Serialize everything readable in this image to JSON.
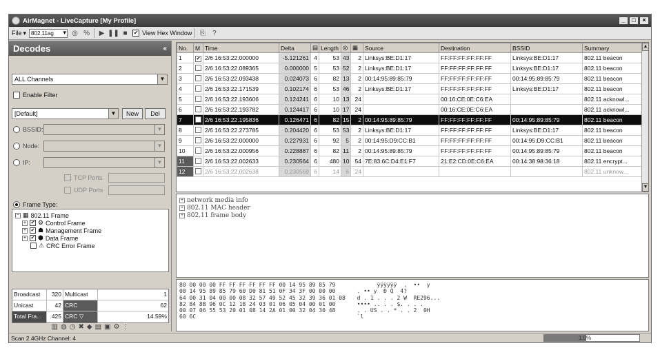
{
  "window": {
    "title": "AirMagnet - LiveCapture [My Profile]",
    "controls": [
      "_",
      "□",
      "×"
    ]
  },
  "toolbar": {
    "file_label": "File",
    "protocol_value": "802.11ag",
    "view_hex_label": "View Hex Window",
    "view_hex_checked": true
  },
  "left": {
    "header": "Decodes",
    "channel_value": "ALL Channels",
    "enable_filter_label": "Enable Filter",
    "filter_value": "[Default]",
    "new_label": "New",
    "del_label": "Del",
    "bssid_label": "BSSID:",
    "node_label": "Node:",
    "ip_label": "IP:",
    "tcp_ports_label": "TCP Ports",
    "udp_ports_label": "UDP Ports",
    "frame_type_label": "Frame Type:",
    "tree": [
      {
        "label": "802.11 Frame",
        "pm": "⊟",
        "level": 0,
        "icon": "frame"
      },
      {
        "label": "Control Frame",
        "pm": "⊞",
        "level": 1,
        "icon": "ctrl"
      },
      {
        "label": "Management Frame",
        "pm": "⊞",
        "level": 1,
        "icon": "mgmt"
      },
      {
        "label": "Data Frame",
        "pm": "⊞",
        "level": 1,
        "icon": "data"
      },
      {
        "label": "CRC Error Frame",
        "pm": "",
        "level": 1,
        "icon": "warn"
      }
    ],
    "stats": {
      "broadcast_label": "Broadcast",
      "broadcast_value": "320",
      "multicast_label": "Multicast",
      "multicast_value": "1",
      "unicast_label": "Unicast",
      "unicast_value": "42",
      "crc_label": "CRC",
      "crc_value": "62",
      "total_label": "Total Fra...",
      "total_value": "425",
      "crc2_label": "CRC",
      "crc2_value": "14.59%"
    }
  },
  "table": {
    "columns": [
      "No.",
      "M",
      "Time",
      "Delta",
      "",
      "Length",
      "",
      "",
      "Source",
      "Destination",
      "BSSID",
      "Summary"
    ],
    "rows": [
      {
        "no": "1",
        "m": "✔",
        "time": "2/6 16:53:22.000000",
        "delta": "-5.121261",
        "c": "4",
        "len": "53",
        "s": "43",
        "f": "2",
        "src": "Linksys:BE:D1:17",
        "dst": "FF:FF:FF:FF:FF:FF",
        "bssid": "Linksys:BE:D1:17",
        "summary": "802.11 beacon"
      },
      {
        "no": "2",
        "m": "",
        "time": "2/6 16:53:22.089365",
        "delta": "0.000000",
        "c": "5",
        "len": "53",
        "s": "52",
        "f": "2",
        "src": "Linksys:BE:D1:17",
        "dst": "FF:FF:FF:FF:FF:FF",
        "bssid": "Linksys:BE:D1:17",
        "summary": "802.11 beacon"
      },
      {
        "no": "3",
        "m": "",
        "time": "2/6 16:53:22.093438",
        "delta": "0.024073",
        "c": "6",
        "len": "82",
        "s": "13",
        "f": "2",
        "src": "00:14:95:89:85:79",
        "dst": "FF:FF:FF:FF:FF:FF",
        "bssid": "00:14:95:89:85:79",
        "summary": "802.11 beacon"
      },
      {
        "no": "4",
        "m": "",
        "time": "2/6 16:53:22.171539",
        "delta": "0.102174",
        "c": "6",
        "len": "53",
        "s": "46",
        "f": "2",
        "src": "Linksys:BE:D1:17",
        "dst": "FF:FF:FF:FF:FF:FF",
        "bssid": "Linksys:BE:D1:17",
        "summary": "802.11 beacon"
      },
      {
        "no": "5",
        "m": "",
        "time": "2/6 16:53:22.193606",
        "delta": "0.124241",
        "c": "6",
        "len": "10",
        "s": "13",
        "f": "24",
        "src": "",
        "dst": "00:16:CE:0E:C6:EA",
        "bssid": "",
        "summary": "802.11 acknowl..."
      },
      {
        "no": "6",
        "m": "",
        "time": "2/6 16:53:22.193782",
        "delta": "0.124417",
        "c": "6",
        "len": "10",
        "s": "17",
        "f": "24",
        "src": "",
        "dst": "00:16:CE:0E:C6:EA",
        "bssid": "",
        "summary": "802.11 acknowl..."
      },
      {
        "no": "7",
        "m": "",
        "time": "2/6 16:53:22.195836",
        "delta": "0.126471",
        "c": "6",
        "len": "82",
        "s": "15",
        "f": "2",
        "src": "00:14:95:89:85:79",
        "dst": "FF:FF:FF:FF:FF:FF",
        "bssid": "00:14:95:89:85:79",
        "summary": "802.11 beacon"
      },
      {
        "no": "8",
        "m": "",
        "time": "2/6 16:53:22.273785",
        "delta": "0.204420",
        "c": "6",
        "len": "53",
        "s": "53",
        "f": "2",
        "src": "Linksys:BE:D1:17",
        "dst": "FF:FF:FF:FF:FF:FF",
        "bssid": "Linksys:BE:D1:17",
        "summary": "802.11 beacon"
      },
      {
        "no": "9",
        "m": "",
        "time": "2/6 16:53:22.000000",
        "delta": "0.227931",
        "c": "6",
        "len": "92",
        "s": "5",
        "f": "2",
        "src": "00:14:95:D9:CC:B1",
        "dst": "FF:FF:FF:FF:FF:FF",
        "bssid": "00:14:95:D9:CC:B1",
        "summary": "802.11 beacon"
      },
      {
        "no": "10",
        "m": "",
        "time": "2/6 16:53:22.000956",
        "delta": "0.228887",
        "c": "6",
        "len": "82",
        "s": "11",
        "f": "2",
        "src": "00:14:95:89:85:79",
        "dst": "FF:FF:FF:FF:FF:FF",
        "bssid": "00:14:95:89:85:79",
        "summary": "802.11 beacon"
      },
      {
        "no": "11",
        "m": "",
        "time": "2/6 16:53:22.002633",
        "delta": "0.230564",
        "c": "6",
        "len": "480",
        "s": "10",
        "f": "54",
        "src": "7E:83:6C:D4:E1:F7",
        "dst": "21:E2:CD:0E:C6:EA",
        "bssid": "00:14:38:98:36:18",
        "summary": "802.11 encrypt..."
      },
      {
        "no": "12",
        "m": "",
        "time": "2/6 16:53:22.002638",
        "delta": "0.230569",
        "c": "6",
        "len": "14",
        "s": "6",
        "f": "24",
        "src": "",
        "dst": "",
        "bssid": "",
        "summary": "802.11 unknow..."
      }
    ],
    "selected_row": "7"
  },
  "detail": [
    {
      "pm": "⊞",
      "label": "network media info"
    },
    {
      "pm": "⊞",
      "label": "802.11 MAC header"
    },
    {
      "pm": "⊞",
      "label": "802.11 frame body"
    }
  ],
  "hex": {
    "bytes": "80 00 00 00 FF FF FF FF FF FF 00 14 95 89 85 79\n00 14 95 89 85 79 60 D0 81 51 0F 34 3F 00 00 00\n64 00 31 04 00 00 08 32 57 49 52 45 32 39 36 01 08\n82 84 8B 96 0C 12 18 24 03 01 06 05 04 00 01 00\n00 07 06 55 53 20 01 08 14 2A 01 00 32 04 30 48\n60 6C",
    "ascii": "       ÿÿÿÿÿÿ  .  ••  y\n . •• y  Ð Q  4?\n d . 1 . . . 2 W  RE296...\n •••• .. . . $. . . .\n . . US . . * . . 2  0H\n `l"
  },
  "status": {
    "text": "Scan 2.4GHz Channel: 4",
    "progress_pct": "1.0%",
    "progress_fraction": 0.44
  }
}
